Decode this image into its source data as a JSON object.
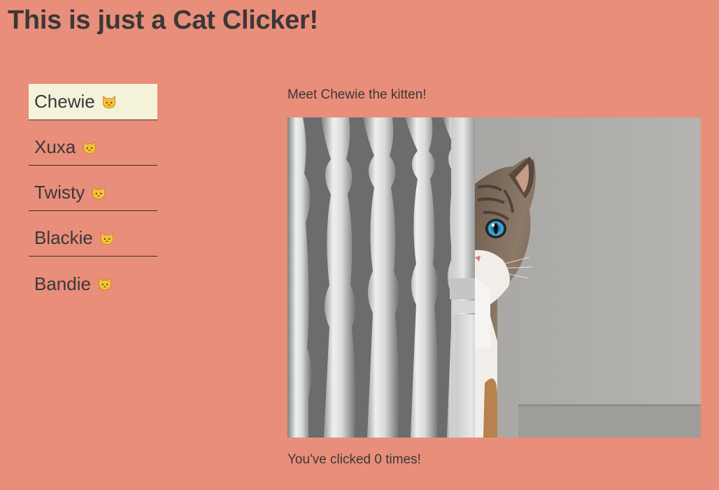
{
  "header": {
    "title": "This is just a Cat Clicker!"
  },
  "sidebar": {
    "items": [
      {
        "label": "Chewie",
        "icon": "cat-face-icon",
        "selected": true
      },
      {
        "label": "Xuxa",
        "icon": "cat-face-icon",
        "selected": false
      },
      {
        "label": "Twisty",
        "icon": "cat-face-icon",
        "selected": false
      },
      {
        "label": "Blackie",
        "icon": "cat-face-icon",
        "selected": false
      },
      {
        "label": "Bandie",
        "icon": "cat-face-icon",
        "selected": false
      }
    ]
  },
  "main": {
    "intro": "Meet Chewie the kitten!",
    "photo": {
      "subject": "cat peeking from behind white stair balusters"
    },
    "counter": "You've clicked 0 times!"
  },
  "colors": {
    "background": "#e98e7a",
    "selected_item": "#f4f3da",
    "text": "#3a3838"
  }
}
